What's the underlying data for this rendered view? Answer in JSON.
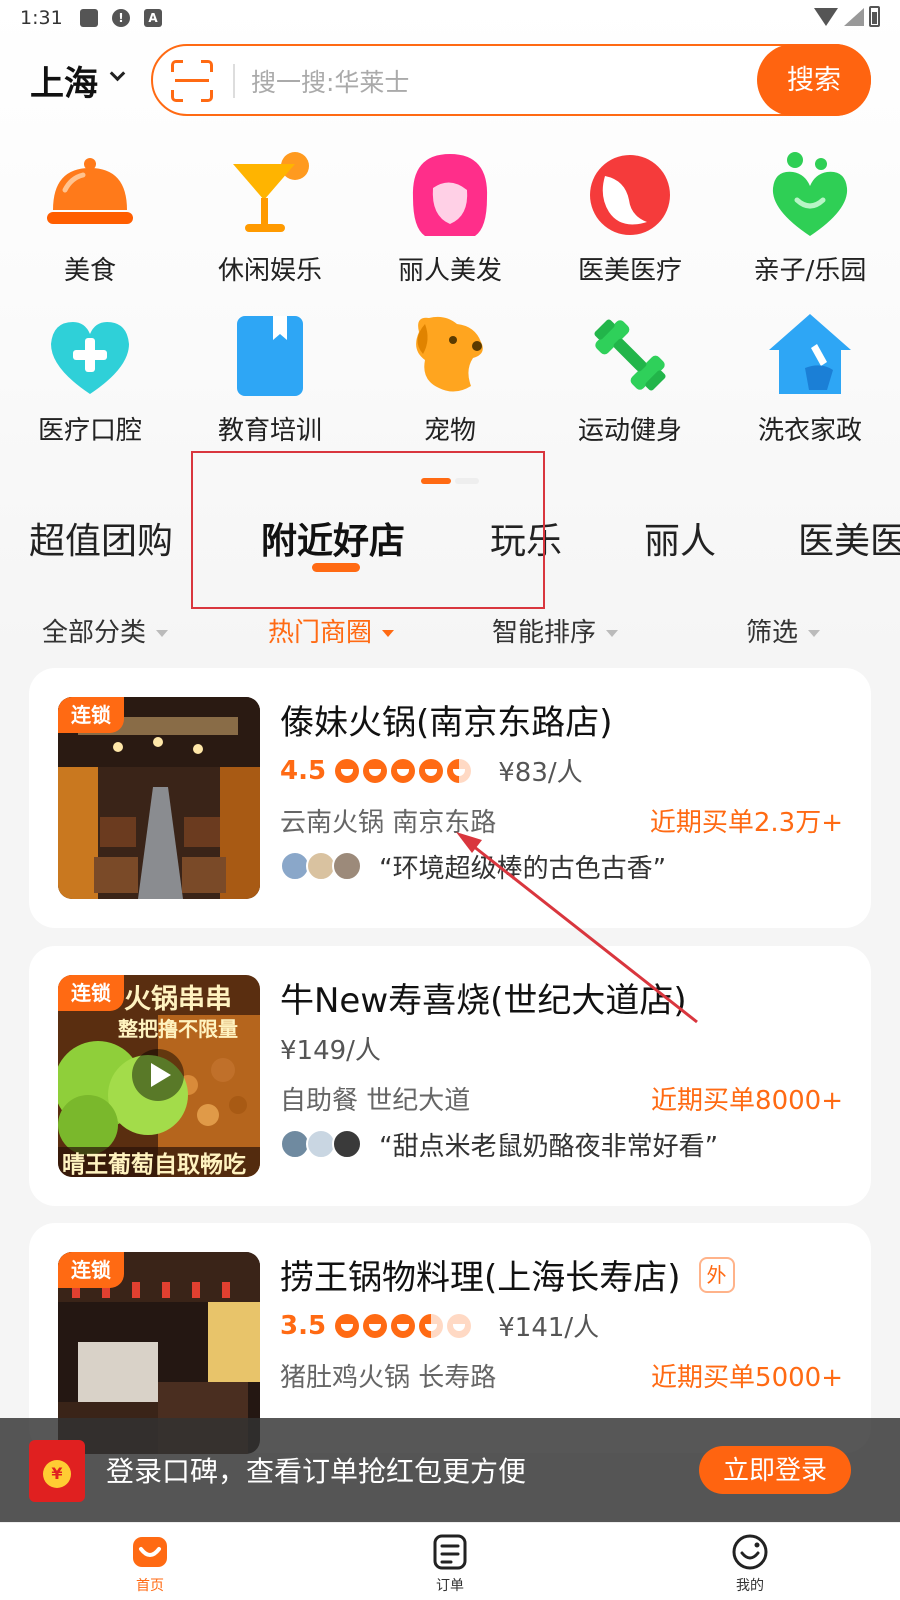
{
  "status_bar": {
    "time": "1:31"
  },
  "header": {
    "city": "上海"
  },
  "search": {
    "placeholder": "搜一搜:华莱士",
    "button": "搜索"
  },
  "categories": [
    {
      "label": "美食",
      "icon": "food-cloche-icon"
    },
    {
      "label": "休闲娱乐",
      "icon": "cocktail-icon"
    },
    {
      "label": "丽人美发",
      "icon": "woman-hair-icon"
    },
    {
      "label": "医美医疗",
      "icon": "face-beauty-icon"
    },
    {
      "label": "亲子/乐园",
      "icon": "heart-family-icon"
    },
    {
      "label": "医疗口腔",
      "icon": "medical-heart-icon"
    },
    {
      "label": "教育培训",
      "icon": "book-icon"
    },
    {
      "label": "宠物",
      "icon": "dog-icon"
    },
    {
      "label": "运动健身",
      "icon": "dumbbell-icon"
    },
    {
      "label": "洗衣家政",
      "icon": "house-broom-icon"
    }
  ],
  "tabs": [
    "超值团购",
    "附近好店",
    "玩乐",
    "丽人",
    "医美医"
  ],
  "filters": [
    "全部分类",
    "热门商圈",
    "智能排序",
    "筛选"
  ],
  "shops": [
    {
      "tag": "连锁",
      "name": "傣妹火锅(南京东路店)",
      "score": "4.5",
      "stars": 4.5,
      "price": "¥83/人",
      "tags": "云南火锅 南京东路",
      "sales": "近期买单2.3万+",
      "review": "“环境超级棒的古色古香”"
    },
    {
      "tag": "连锁",
      "name": "牛New寿喜烧(世纪大道店)",
      "price": "¥149/人",
      "tags": "自助餐 世纪大道",
      "sales": "近期买单8000+",
      "review": "“甜点米老鼠奶酪夜非常好看”",
      "thumb_text_top": "火锅串串",
      "thumb_text_mid": "整把撸不限量",
      "thumb_text_bottom": "晴王葡萄自取畅吃"
    },
    {
      "tag": "连锁",
      "name": "捞王锅物料理(上海长寿店)",
      "badge": "外",
      "score": "3.5",
      "stars": 3.5,
      "price": "¥141/人",
      "tags": "猪肚鸡火锅 长寿路",
      "sales": "近期买单5000+"
    }
  ],
  "login_banner": {
    "text": "登录口碑，查看订单抢红包更方便",
    "button": "立即登录",
    "coin": "¥"
  },
  "bottom_nav": [
    {
      "label": "首页",
      "icon": "home-smile-icon"
    },
    {
      "label": "订单",
      "icon": "order-list-icon"
    },
    {
      "label": "我的",
      "icon": "profile-smile-icon"
    }
  ],
  "colors": {
    "accent": "#ff6a13",
    "annotation": "#d9363e"
  }
}
